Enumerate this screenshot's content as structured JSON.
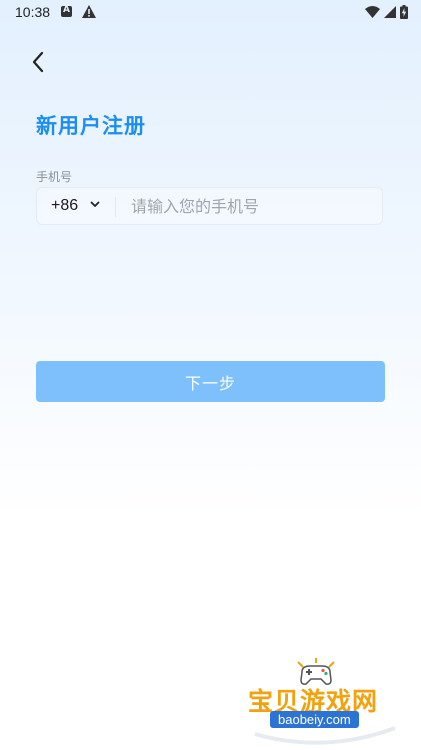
{
  "status_bar": {
    "time": "10:38",
    "icons": [
      "notification-a-icon",
      "warning-icon",
      "wifi-icon",
      "cell-signal-icon",
      "battery-charging-icon"
    ]
  },
  "header": {
    "back_icon": "chevron-left-icon",
    "title": "新用户注册"
  },
  "form": {
    "phone_label": "手机号",
    "country_code": "+86",
    "phone_placeholder": "请输入您的手机号",
    "phone_value": ""
  },
  "actions": {
    "next_label": "下一步"
  },
  "watermark": {
    "text": "宝贝游戏网",
    "domain": "baobeiy.com"
  },
  "colors": {
    "accent": "#1c8ef0",
    "button_disabled": "#7ec0fb",
    "background_top": "#e3f0fe"
  }
}
